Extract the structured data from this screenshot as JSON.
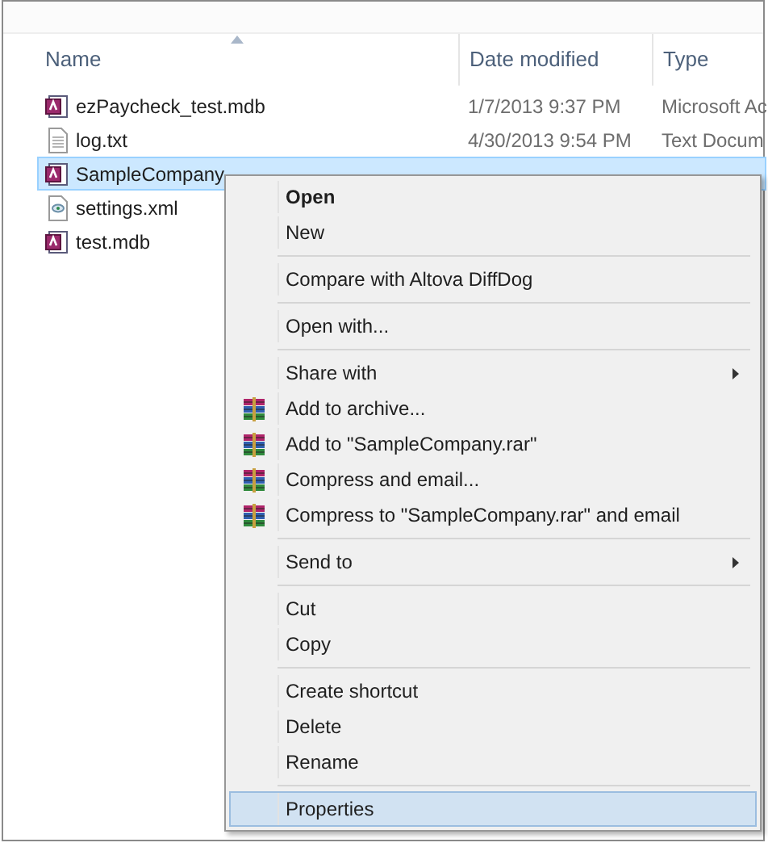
{
  "columns": [
    {
      "label": "Name",
      "sorted": true
    },
    {
      "label": "Date modified",
      "sorted": false
    },
    {
      "label": "Type",
      "sorted": false
    }
  ],
  "files": [
    {
      "name": "ezPaycheck_test.mdb",
      "kind": "database",
      "date": "1/7/2013 9:37 PM",
      "type": "Microsoft Ac",
      "selected": false
    },
    {
      "name": "log.txt",
      "kind": "text",
      "date": "4/30/2013 9:54 PM",
      "type": "Text Docum",
      "selected": false
    },
    {
      "name": "SampleCompany",
      "kind": "database",
      "selected": true
    },
    {
      "name": "settings.xml",
      "kind": "config",
      "selected": false
    },
    {
      "name": "test.mdb",
      "kind": "database",
      "selected": false
    }
  ],
  "context_menu": [
    {
      "kind": "item",
      "label": "Open",
      "default": true,
      "selected": false
    },
    {
      "kind": "item",
      "label": "New",
      "selected": false
    },
    {
      "kind": "separator"
    },
    {
      "kind": "item",
      "label": "Compare with Altova DiffDog",
      "selected": false
    },
    {
      "kind": "separator"
    },
    {
      "kind": "item",
      "label": "Open with...",
      "selected": false
    },
    {
      "kind": "separator"
    },
    {
      "kind": "item",
      "label": "Share with",
      "submenu": true,
      "selected": false
    },
    {
      "kind": "archive",
      "label": "Add to archive...",
      "selected": false
    },
    {
      "kind": "archive",
      "label": "Add to \"SampleCompany.rar\"",
      "selected": false
    },
    {
      "kind": "archive",
      "label": "Compress and email...",
      "selected": false
    },
    {
      "kind": "archive",
      "label": "Compress to \"SampleCompany.rar\" and email",
      "selected": false
    },
    {
      "kind": "separator"
    },
    {
      "kind": "item",
      "label": "Send to",
      "submenu": true,
      "selected": false
    },
    {
      "kind": "separator"
    },
    {
      "kind": "item",
      "label": "Cut",
      "selected": false
    },
    {
      "kind": "item",
      "label": "Copy",
      "selected": false
    },
    {
      "kind": "separator"
    },
    {
      "kind": "item",
      "label": "Create shortcut",
      "selected": false
    },
    {
      "kind": "item",
      "label": "Delete",
      "selected": false
    },
    {
      "kind": "item",
      "label": "Rename",
      "selected": false
    },
    {
      "kind": "separator"
    },
    {
      "kind": "item",
      "label": "Properties",
      "selected": true
    }
  ]
}
